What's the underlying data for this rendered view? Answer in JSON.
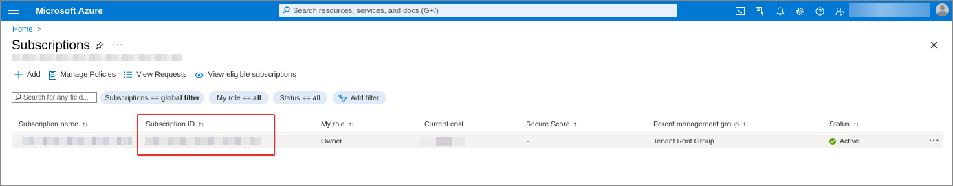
{
  "topbar": {
    "brand": "Microsoft Azure",
    "search_placeholder": "Search resources, services, and docs (G+/)",
    "icons": [
      "cloud-shell-icon",
      "directory-filter-icon",
      "bell-icon",
      "gear-icon",
      "help-icon",
      "feedback-icon"
    ]
  },
  "breadcrumb": {
    "home": "Home",
    "separator": ">"
  },
  "page": {
    "title": "Subscriptions",
    "more": "···"
  },
  "commands": {
    "add": "Add",
    "manage_policies": "Manage Policies",
    "view_requests": "View Requests",
    "view_eligible": "View eligible subscriptions"
  },
  "filters": {
    "search_placeholder": "Search for any field...",
    "pill1": {
      "label": "Subscriptions",
      "op": "==",
      "value": "global filter"
    },
    "pill2": {
      "label": "My role",
      "op": "==",
      "value": "all"
    },
    "pill3": {
      "label": "Status",
      "op": "==",
      "value": "all"
    },
    "add_filter": "Add filter"
  },
  "table": {
    "columns": [
      "Subscription name",
      "Subscription ID",
      "My role",
      "Current cost",
      "Secure Score",
      "Parent management group",
      "Status"
    ],
    "sort_glyph": "↑↓",
    "rows": [
      {
        "my_role": "Owner",
        "secure_score": "-",
        "parent_group": "Tenant Root Group",
        "status": "Active"
      }
    ],
    "row_more": "···"
  },
  "colors": {
    "accent": "#0078d4",
    "highlight": "#e03131",
    "status_active": "#57a300"
  }
}
